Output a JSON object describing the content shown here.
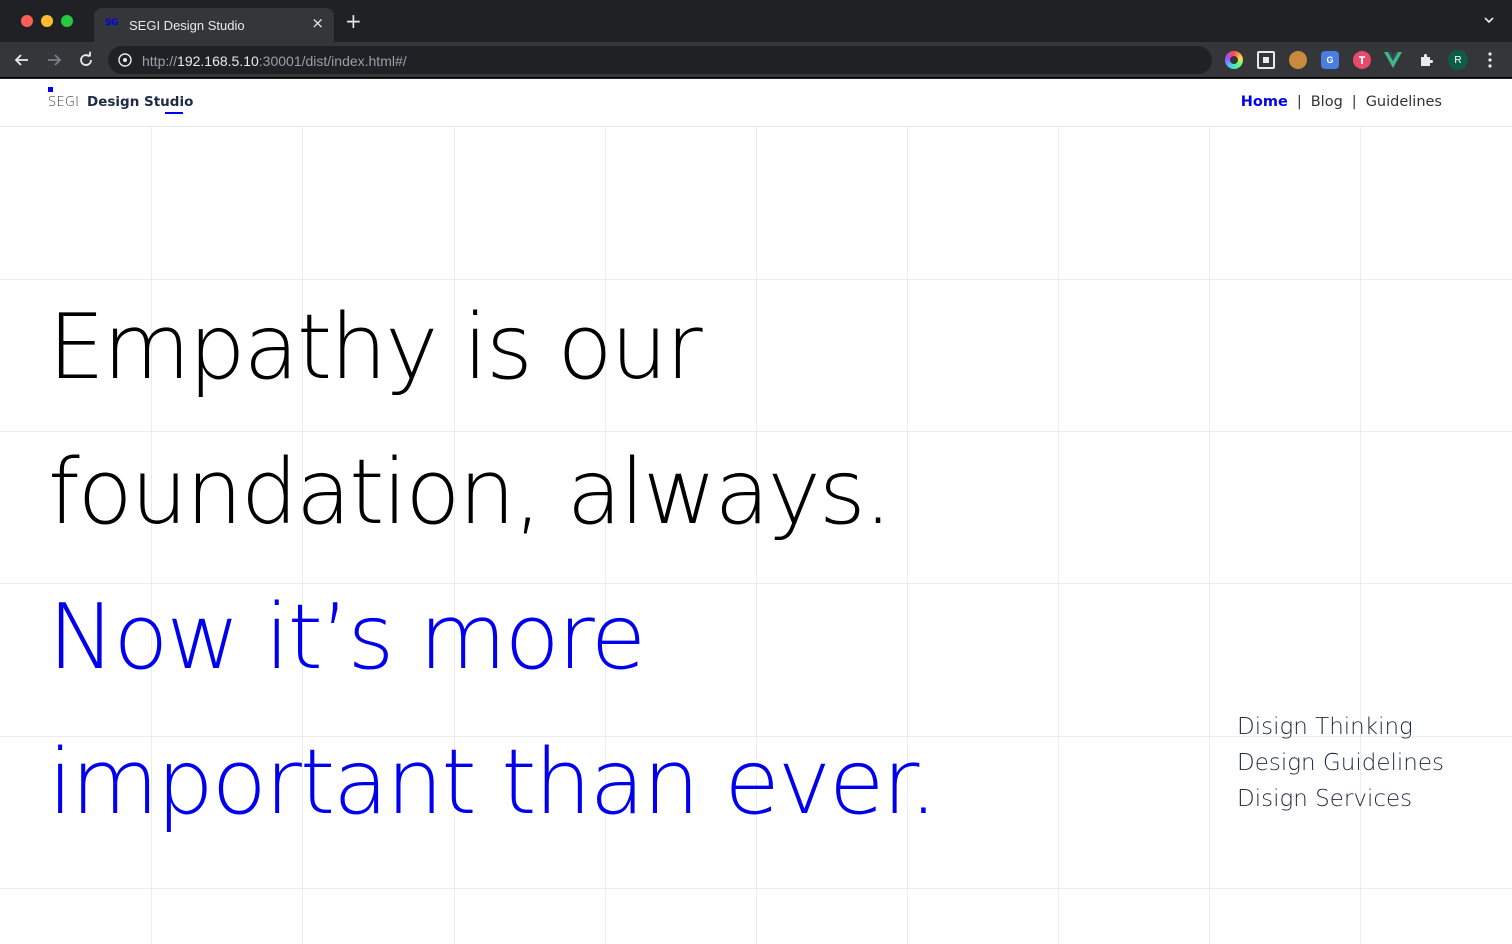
{
  "browser": {
    "tab": {
      "favicon_text": "SG",
      "title": "SEGI Design Studio"
    },
    "url": {
      "scheme": "http://",
      "host": "192.168.5.10",
      "path": ":30001/dist/index.html#/"
    },
    "profile_initial": "R",
    "extensions": [
      "color-picker-icon",
      "window-frame-icon",
      "cookie-icon",
      "translate-icon",
      "t-extension-icon",
      "vue-devtools-icon",
      "puzzle-icon"
    ],
    "extension_labels": {
      "translate": "G"
    }
  },
  "site": {
    "logo": {
      "prefix": "SEGI",
      "name": "Design Studio"
    },
    "nav": [
      {
        "label": "Home",
        "active": true
      },
      {
        "label": "Blog",
        "active": false
      },
      {
        "label": "Guidelines",
        "active": false
      }
    ],
    "nav_separator": "|",
    "hero": {
      "line1": "Empathy is our",
      "line2": "foundation, always.",
      "line3": "Now it’s more",
      "line4": "important than ever."
    },
    "side_links": [
      "Disign Thinking",
      "Design Guidelines",
      "Disign Services"
    ]
  },
  "colors": {
    "accent": "#0000ee",
    "text_dark": "#000000",
    "text_muted": "#1f2a44",
    "grid": "#ececec",
    "chrome_bg": "#202124",
    "chrome_toolbar": "#35363a"
  }
}
